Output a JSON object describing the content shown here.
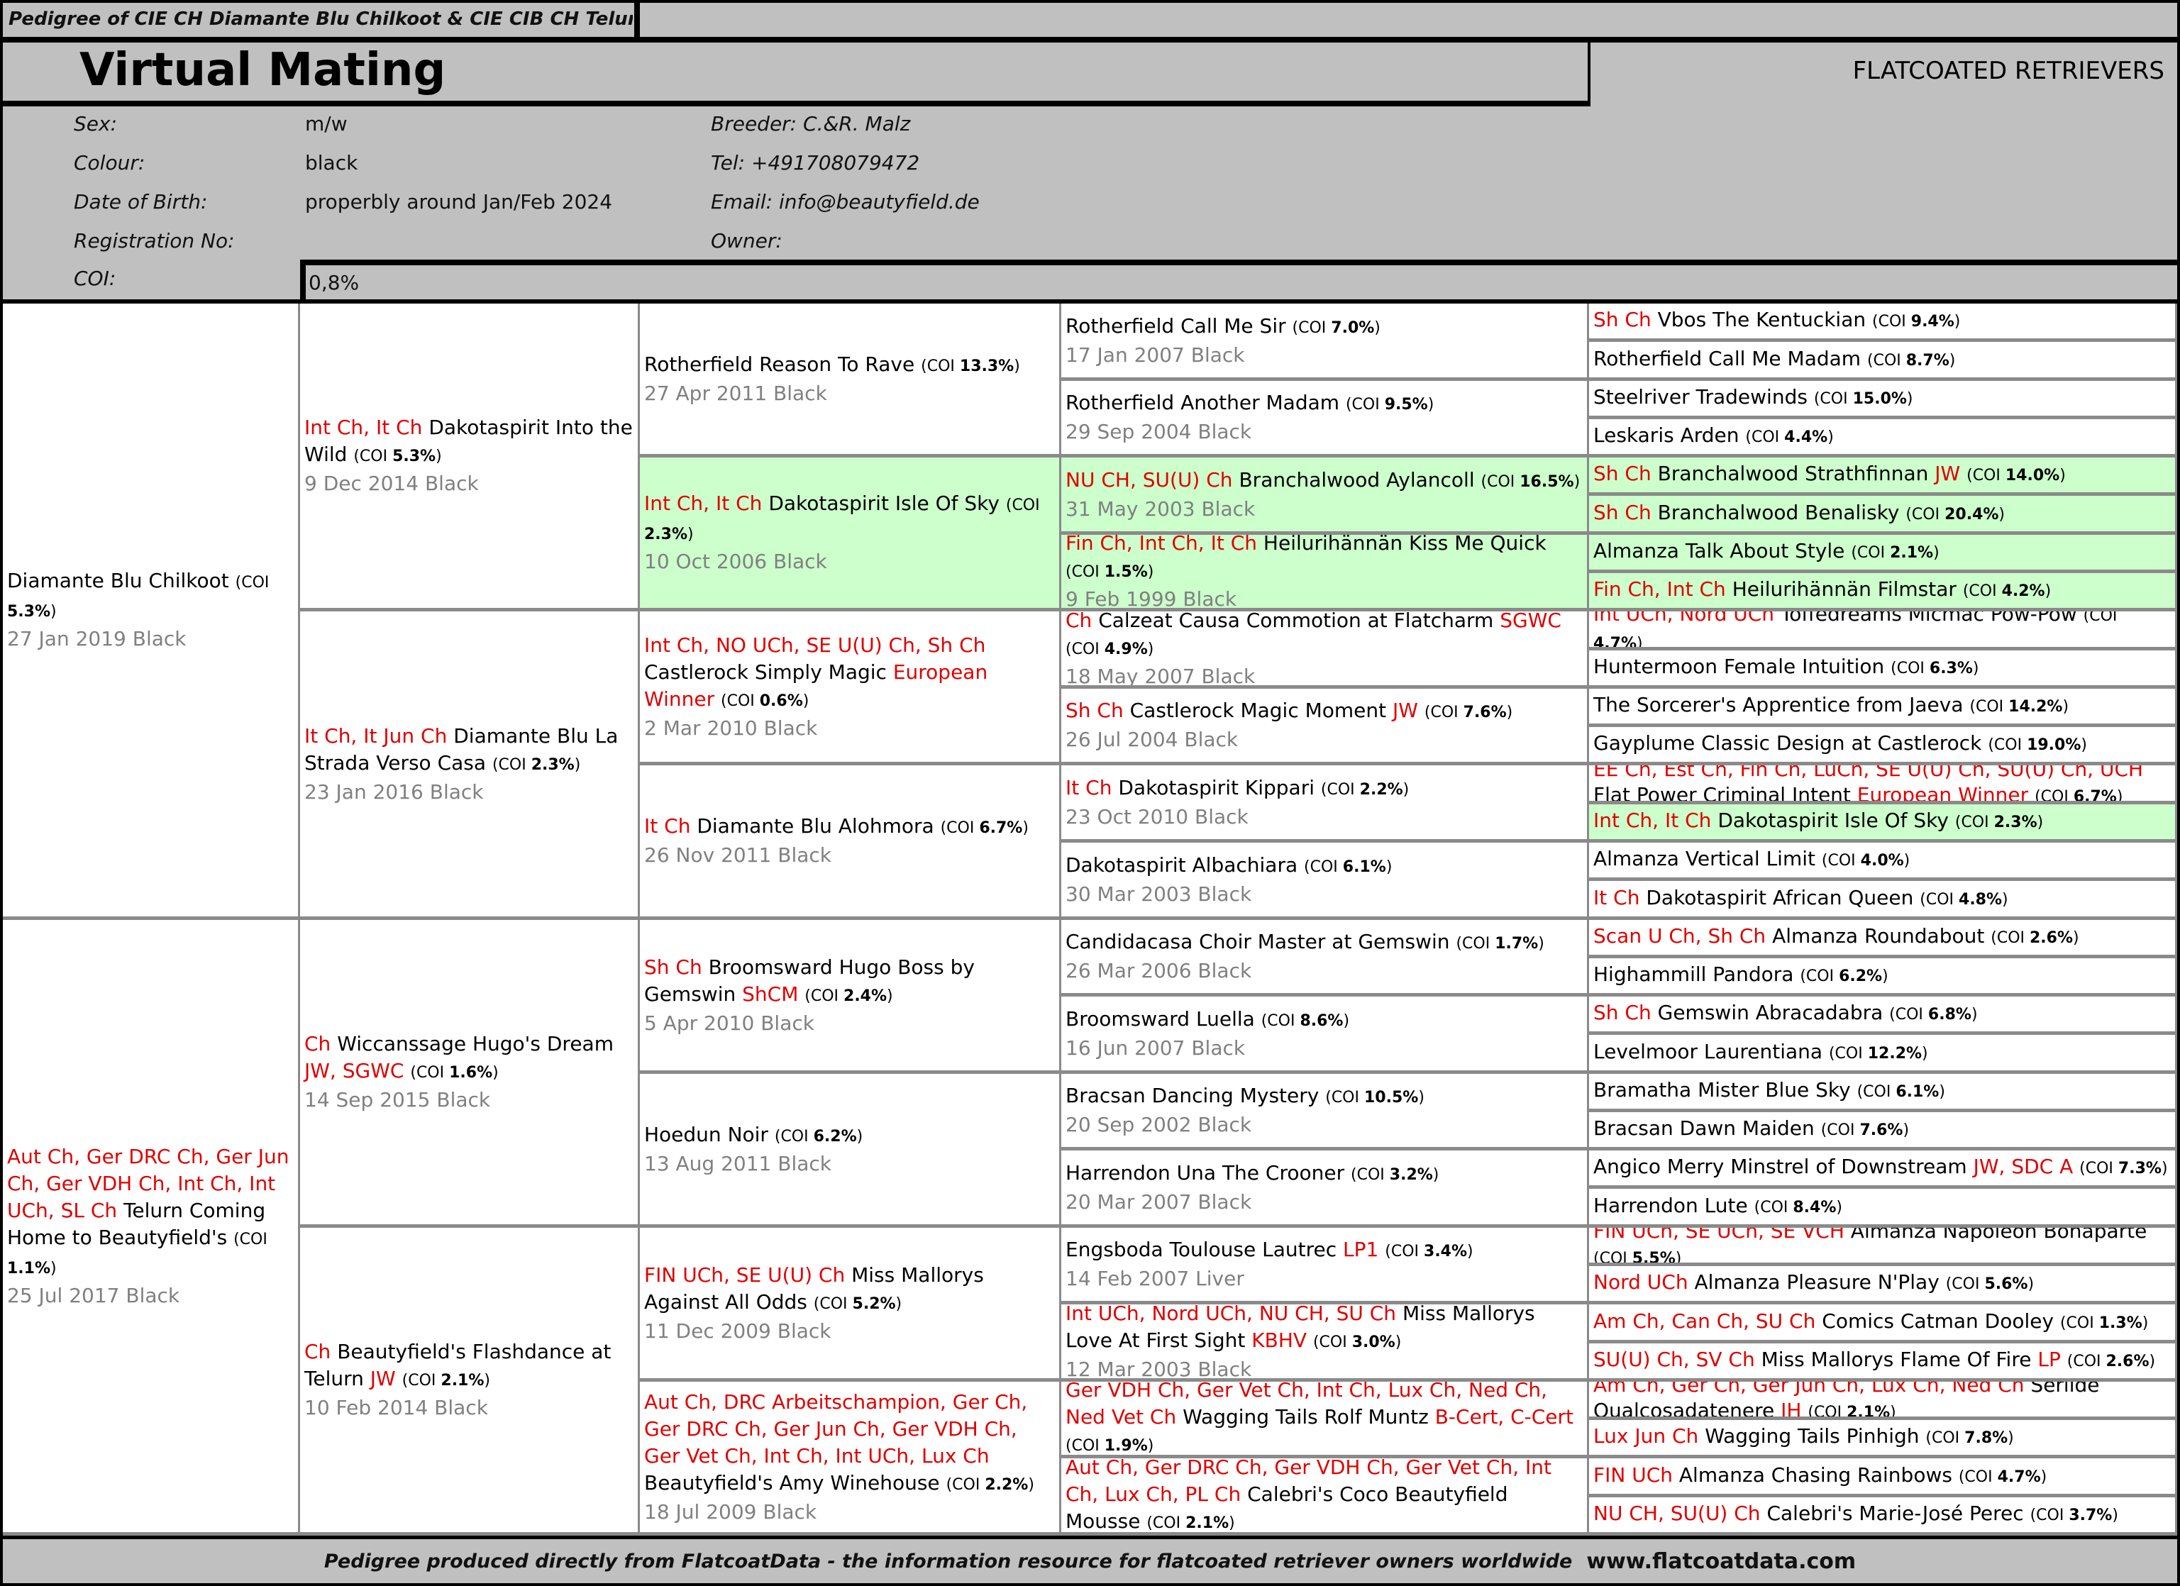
{
  "top_title": "Pedigree of CIE CH Diamante Blu Chilkoot & CIE CIB CH Telurn Coming Home to Beautyfield's",
  "header": {
    "title": "Virtual Mating",
    "breed": "FLATCOATED RETRIEVERS",
    "fields": [
      {
        "label": "Sex:",
        "value": "m/w"
      },
      {
        "label": "Colour:",
        "value": "black"
      },
      {
        "label": "Date of Birth:",
        "value": "properbly around Jan/Feb 2024"
      },
      {
        "label": "Registration No:",
        "value": ""
      },
      {
        "label": "COI:",
        "value": "0,8%"
      }
    ],
    "breeder": "Breeder: C.&R. Malz",
    "tel": "Tel: +491708079472",
    "email": "Email: info@beautyfield.de",
    "owner": "Owner:"
  },
  "coi_label": "COI",
  "colors": {
    "title_red": "#e00000",
    "highlight_green": "#ccffcc",
    "header_grey": "#c0c0c0",
    "dob_grey": "#808080"
  },
  "pedigree": {
    "gen1": [
      {
        "titles": "",
        "name": "Diamante Blu Chilkoot",
        "suffix": "",
        "coi": "5.3%",
        "dob": "27 Jan 2019 Black"
      },
      {
        "titles": "Aut Ch, Ger DRC Ch, Ger Jun Ch, Ger VDH Ch, Int Ch, Int UCh, SL Ch",
        "name": "Telurn Coming Home to Beautyfield's",
        "suffix": "",
        "coi": "1.1%",
        "dob": "25 Jul 2017 Black"
      }
    ],
    "gen2": [
      {
        "titles": "Int Ch, It Ch",
        "name": "Dakotaspirit Into the Wild",
        "suffix": "",
        "coi": "5.3%",
        "dob": "9 Dec 2014 Black"
      },
      {
        "titles": "It Ch, It Jun Ch",
        "name": "Diamante Blu La Strada Verso Casa",
        "suffix": "",
        "coi": "2.3%",
        "dob": "23 Jan 2016 Black"
      },
      {
        "titles": "Ch",
        "name": "Wiccanssage Hugo's Dream",
        "suffix": "JW, SGWC",
        "coi": "1.6%",
        "dob": "14 Sep 2015 Black"
      },
      {
        "titles": "Ch",
        "name": "Beautyfield's Flashdance at Telurn",
        "suffix": "JW",
        "coi": "2.1%",
        "dob": "10 Feb 2014 Black"
      }
    ],
    "gen3": [
      {
        "titles": "",
        "name": "Rotherfield Reason To Rave",
        "suffix": "",
        "coi": "13.3%",
        "dob": "27 Apr 2011 Black",
        "highlight": false
      },
      {
        "titles": "Int Ch, It Ch",
        "name": "Dakotaspirit Isle Of Sky",
        "suffix": "",
        "coi": "2.3%",
        "dob": "10 Oct 2006 Black",
        "highlight": true
      },
      {
        "titles": "Int Ch, NO UCh, SE U(U) Ch, Sh Ch",
        "name": "Castlerock Simply Magic",
        "suffix": "European Winner",
        "coi": "0.6%",
        "dob": "2 Mar 2010 Black",
        "highlight": false
      },
      {
        "titles": "It Ch",
        "name": "Diamante Blu Alohmora",
        "suffix": "",
        "coi": "6.7%",
        "dob": "26 Nov 2011 Black",
        "highlight": false
      },
      {
        "titles": "Sh Ch",
        "name": "Broomsward Hugo Boss by Gemswin",
        "suffix": "ShCM",
        "coi": "2.4%",
        "dob": "5 Apr 2010 Black",
        "highlight": false
      },
      {
        "titles": "",
        "name": "Hoedun Noir",
        "suffix": "",
        "coi": "6.2%",
        "dob": "13 Aug 2011 Black",
        "highlight": false
      },
      {
        "titles": "FIN UCh, SE U(U) Ch",
        "name": "Miss Mallorys Against All Odds",
        "suffix": "",
        "coi": "5.2%",
        "dob": "11 Dec 2009 Black",
        "highlight": false
      },
      {
        "titles": "Aut Ch, DRC Arbeitschampion, Ger Ch, Ger DRC Ch, Ger Jun Ch, Ger VDH Ch, Ger Vet Ch, Int Ch, Int UCh, Lux Ch",
        "name": "Beautyfield's Amy Winehouse",
        "suffix": "",
        "coi": "2.2%",
        "dob": "18 Jul 2009 Black",
        "highlight": false
      }
    ],
    "gen4": [
      {
        "titles": "",
        "name": "Rotherfield Call Me Sir",
        "suffix": "",
        "coi": "7.0%",
        "dob": "17 Jan 2007 Black",
        "highlight": false
      },
      {
        "titles": "",
        "name": "Rotherfield Another Madam",
        "suffix": "",
        "coi": "9.5%",
        "dob": "29 Sep 2004 Black",
        "highlight": false
      },
      {
        "titles": "NU CH, SU(U) Ch",
        "name": "Branchalwood Aylancoll ",
        "suffix": "",
        "coi": "16.5%",
        "dob": "31 May 2003 Black",
        "highlight": true
      },
      {
        "titles": "Fin Ch, Int Ch, It Ch",
        "name": "Heilurihännän Kiss Me Quick",
        "suffix": "",
        "coi": "1.5%",
        "dob": "9 Feb 1999 Black",
        "highlight": true
      },
      {
        "titles": "Ch",
        "name": "Calzeat Causa Commotion at Flatcharm",
        "suffix": "SGWC",
        "coi": "4.9%",
        "dob": "18 May 2007 Black",
        "highlight": false
      },
      {
        "titles": "Sh Ch",
        "name": "Castlerock Magic Moment",
        "suffix": "JW",
        "coi": "7.6%",
        "dob": "26 Jul 2004 Black",
        "highlight": false
      },
      {
        "titles": "It Ch",
        "name": "Dakotaspirit Kippari",
        "suffix": "",
        "coi": "2.2%",
        "dob": "23 Oct 2010 Black",
        "highlight": false
      },
      {
        "titles": "",
        "name": "Dakotaspirit Albachiara",
        "suffix": "",
        "coi": "6.1%",
        "dob": "30 Mar 2003 Black",
        "highlight": false
      },
      {
        "titles": "",
        "name": "Candidacasa Choir Master at Gemswin",
        "suffix": "",
        "coi": "1.7%",
        "dob": "26 Mar 2006 Black",
        "highlight": false
      },
      {
        "titles": "",
        "name": "Broomsward Luella",
        "suffix": "",
        "coi": "8.6%",
        "dob": "16 Jun 2007 Black",
        "highlight": false
      },
      {
        "titles": "",
        "name": "Bracsan Dancing Mystery",
        "suffix": "",
        "coi": "10.5%",
        "dob": "20 Sep 2002 Black",
        "highlight": false
      },
      {
        "titles": "",
        "name": "Harrendon Una The Crooner",
        "suffix": "",
        "coi": "3.2%",
        "dob": "20 Mar 2007 Black",
        "highlight": false
      },
      {
        "titles": "",
        "name": "Engsboda Toulouse Lautrec",
        "suffix": "LP1",
        "coi": "3.4%",
        "dob": "14 Feb 2007 Liver",
        "highlight": false
      },
      {
        "titles": "Int UCh, Nord UCh, NU CH, SU Ch",
        "name": "Miss Mallorys Love At First Sight",
        "suffix": "KBHV",
        "coi": "3.0%",
        "dob": "12 Mar 2003 Black",
        "highlight": false
      },
      {
        "titles": "Ger VDH Ch, Ger Vet Ch, Int Ch, Lux Ch, Ned Ch, Ned Vet Ch",
        "name": "Wagging Tails Rolf Muntz",
        "suffix": "B-Cert, C-Cert",
        "coi": "1.9%",
        "dob": "",
        "highlight": false
      },
      {
        "titles": "Aut Ch, Ger DRC Ch, Ger VDH Ch, Ger Vet Ch, Int Ch, Lux Ch, PL Ch",
        "name": "Calebri's Coco Beautyfield Mousse",
        "suffix": "",
        "coi": "2.1%",
        "dob": "",
        "highlight": false
      }
    ],
    "gen5": [
      {
        "titles": "Sh Ch",
        "name": "Vbos The Kentuckian",
        "suffix": "",
        "coi": "9.4%",
        "highlight": false
      },
      {
        "titles": "",
        "name": "Rotherfield Call Me Madam",
        "suffix": "",
        "coi": "8.7%",
        "highlight": false
      },
      {
        "titles": "",
        "name": "Steelriver Tradewinds",
        "suffix": "",
        "coi": "15.0%",
        "highlight": false
      },
      {
        "titles": "",
        "name": "Leskaris Arden",
        "suffix": "",
        "coi": "4.4%",
        "highlight": false
      },
      {
        "titles": "Sh Ch",
        "name": "Branchalwood Strathfinnan",
        "suffix": "JW",
        "coi": "14.0%",
        "highlight": true
      },
      {
        "titles": "Sh Ch",
        "name": "Branchalwood Benalisky",
        "suffix": "",
        "coi": "20.4%",
        "highlight": true
      },
      {
        "titles": "",
        "name": "Almanza Talk About Style",
        "suffix": "",
        "coi": "2.1%",
        "highlight": true
      },
      {
        "titles": "Fin Ch, Int Ch",
        "name": "Heilurihännän Filmstar",
        "suffix": "",
        "coi": "4.2%",
        "highlight": true
      },
      {
        "titles": "Int UCh, Nord UCh",
        "name": "Toffedreams Micmac Pow-Pow",
        "suffix": "",
        "coi": "4.7%",
        "highlight": false
      },
      {
        "titles": "",
        "name": "Huntermoon Female Intuition",
        "suffix": "",
        "coi": "6.3%",
        "highlight": false
      },
      {
        "titles": "",
        "name": "The Sorcerer's Apprentice from Jaeva",
        "suffix": "",
        "coi": "14.2%",
        "highlight": false
      },
      {
        "titles": "",
        "name": "Gayplume Classic Design at Castlerock",
        "suffix": "",
        "coi": "19.0%",
        "highlight": false
      },
      {
        "titles": "EE Ch, Est Ch, Fin Ch, LuCh, SE U(U) Ch, SU(U) Ch, UCH",
        "name": "Flat Power Criminal Intent",
        "suffix": "European Winner",
        "coi": "6.7%",
        "highlight": false
      },
      {
        "titles": "Int Ch, It Ch",
        "name": "Dakotaspirit Isle Of Sky",
        "suffix": "",
        "coi": "2.3%",
        "highlight": true
      },
      {
        "titles": "",
        "name": "Almanza Vertical Limit",
        "suffix": "",
        "coi": "4.0%",
        "highlight": false
      },
      {
        "titles": "It Ch",
        "name": "Dakotaspirit African Queen",
        "suffix": "",
        "coi": "4.8%",
        "highlight": false
      },
      {
        "titles": "Scan U Ch, Sh Ch",
        "name": "Almanza Roundabout ",
        "suffix": "",
        "coi": "2.6%",
        "highlight": false
      },
      {
        "titles": "",
        "name": "Highammill Pandora",
        "suffix": "",
        "coi": "6.2%",
        "highlight": false
      },
      {
        "titles": "Sh Ch",
        "name": "Gemswin Abracadabra",
        "suffix": "",
        "coi": "6.8%",
        "highlight": false
      },
      {
        "titles": "",
        "name": "Levelmoor Laurentiana",
        "suffix": "",
        "coi": "12.2%",
        "highlight": false
      },
      {
        "titles": "",
        "name": "Bramatha Mister Blue Sky",
        "suffix": "",
        "coi": "6.1%",
        "highlight": false
      },
      {
        "titles": "",
        "name": "Bracsan Dawn Maiden",
        "suffix": "",
        "coi": "7.6%",
        "highlight": false
      },
      {
        "titles": "",
        "name": "Angico Merry Minstrel of Downstream",
        "suffix": "JW, SDC A",
        "coi": "7.3%",
        "highlight": false
      },
      {
        "titles": "",
        "name": "Harrendon Lute",
        "suffix": "",
        "coi": "8.4%",
        "highlight": false
      },
      {
        "titles": "FIN UCh, SE UCh, SE VCH",
        "name": "Almanza Napoleon Bonaparte",
        "suffix": "",
        "coi": "5.5%",
        "highlight": false
      },
      {
        "titles": "Nord UCh",
        "name": "Almanza Pleasure N'Play",
        "suffix": "",
        "coi": "5.6%",
        "highlight": false
      },
      {
        "titles": "Am Ch, Can Ch, SU Ch",
        "name": "Comics Catman Dooley",
        "suffix": "",
        "coi": "1.3%",
        "highlight": false
      },
      {
        "titles": "SU(U) Ch, SV Ch",
        "name": "Miss Mallorys Flame Of Fire",
        "suffix": "LP",
        "coi": "2.6%",
        "highlight": false
      },
      {
        "titles": "Am Ch, Ger Ch, Ger Jun Ch, Lux Ch, Ned Ch",
        "name": "Serlide Qualcosadatenere",
        "suffix": "JH",
        "coi": "2.1%",
        "highlight": false
      },
      {
        "titles": "Lux Jun Ch",
        "name": "Wagging Tails Pinhigh",
        "suffix": "",
        "coi": "7.8%",
        "highlight": false
      },
      {
        "titles": "FIN UCh",
        "name": "Almanza Chasing Rainbows",
        "suffix": "",
        "coi": "4.7%",
        "highlight": false
      },
      {
        "titles": "NU CH, SU(U) Ch",
        "name": "Calebri's Marie-José Perec",
        "suffix": "",
        "coi": "3.7%",
        "highlight": false
      }
    ]
  },
  "footer": {
    "text": "Pedigree produced directly from FlatcoatData - the information resource for flatcoated retriever owners worldwide",
    "url": "www.flatcoatdata.com"
  }
}
